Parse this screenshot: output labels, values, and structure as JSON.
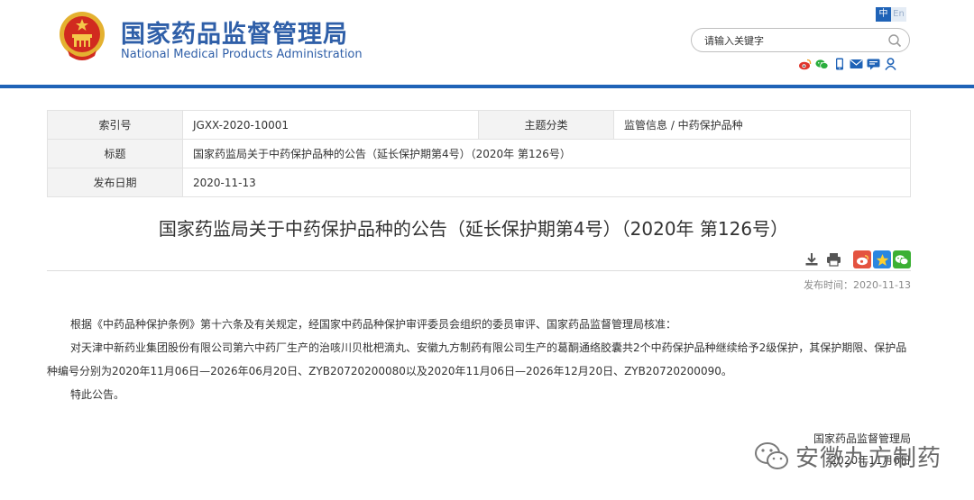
{
  "header": {
    "title_cn": "国家药品监督管理局",
    "title_en": "National Medical Products Administration",
    "lang_cn": "中",
    "lang_en": "En",
    "search_placeholder": "请输入关键字",
    "icons": [
      "weibo-icon",
      "wechat-icon",
      "mobile-icon",
      "mail-icon",
      "message-icon",
      "user-icon"
    ]
  },
  "meta": {
    "index_label": "索引号",
    "index_value": "JGXX-2020-10001",
    "topic_label": "主题分类",
    "topic_value": "监管信息 / 中药保护品种",
    "title_label": "标题",
    "title_value": "国家药监局关于中药保护品种的公告（延长保护期第4号）（2020年 第126号）",
    "date_label": "发布日期",
    "date_value": "2020-11-13"
  },
  "article": {
    "title": "国家药监局关于中药保护品种的公告（延长保护期第4号）（2020年 第126号）",
    "pub_label": "发布时间：2020-11-13",
    "p1": "根据《中药品种保护条例》第十六条及有关规定，经国家中药品种保护审评委员会组织的委员审评、国家药品监督管理局核准：",
    "p2": "对天津中新药业集团股份有限公司第六中药厂生产的治咳川贝枇杷滴丸、安徽九方制药有限公司生产的葛酮通络胶囊共2个中药保护品种继续给予2级保护，其保护期限、保护品种编号分别为2020年11月06日—2026年06月20日、ZYB20720200080以及2020年11月06日—2026年12月20日、ZYB20720200090。",
    "p3": "特此公告。",
    "signer": "国家药品监督管理局",
    "sign_date": "2020年11月6日"
  },
  "watermark": {
    "text": "安徽九方制药"
  },
  "colors": {
    "brand_blue": "#1f63b7",
    "title_blue": "#2f5fa8"
  }
}
